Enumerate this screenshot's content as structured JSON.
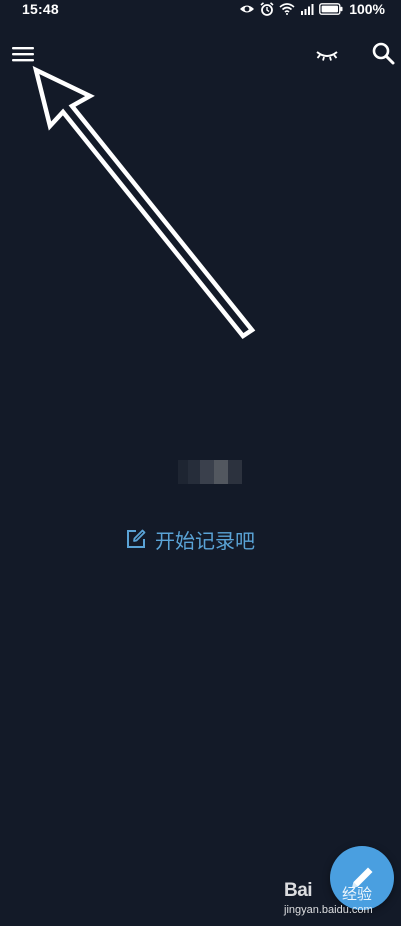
{
  "status_bar": {
    "time": "15:48",
    "battery_percent": "100%",
    "icons": [
      "eye-icon",
      "alarm-icon",
      "wifi-icon",
      "signal-icon",
      "battery-icon"
    ]
  },
  "toolbar": {
    "menu_icon": "hamburger-menu-icon",
    "hide_icon": "closed-eye-icon",
    "search_icon": "search-icon"
  },
  "empty_state": {
    "cta_label": "开始记录吧",
    "cta_icon": "edit-icon"
  },
  "fab": {
    "icon": "pencil-icon"
  },
  "watermark": {
    "brand": "Bai",
    "brand_suffix": "经验",
    "url": "jingyan.baidu.com"
  },
  "colors": {
    "background": "#131a28",
    "accent": "#5aa3d6",
    "fab": "#4a9fe0",
    "icon": "#ffffff"
  }
}
